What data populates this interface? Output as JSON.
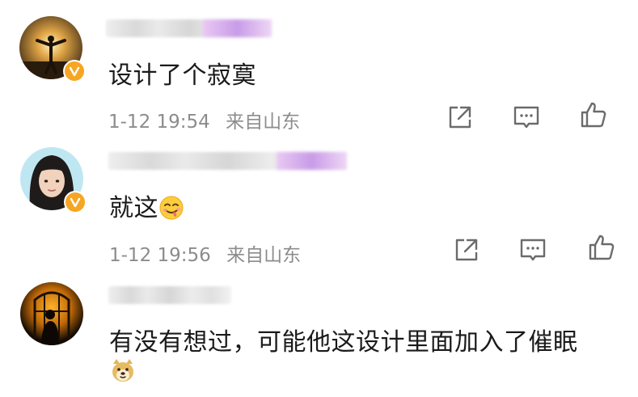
{
  "comments": [
    {
      "text": "设计了个寂寞",
      "date": "1-12 19:54",
      "location": "来自山东",
      "verified": true
    },
    {
      "text": "就这",
      "date": "1-12 19:56",
      "location": "来自山东",
      "verified": true,
      "emoji": "yummy-face-emoji"
    },
    {
      "text": "有没有想过，可能他这设计里面加入了催眠",
      "verified": false,
      "emoji": "doge-emoji"
    }
  ],
  "colors": {
    "badge": "#f6a623",
    "meta_text": "#8c8c8c",
    "body_text": "#1a1a1a",
    "icon": "#6b6b6b"
  }
}
